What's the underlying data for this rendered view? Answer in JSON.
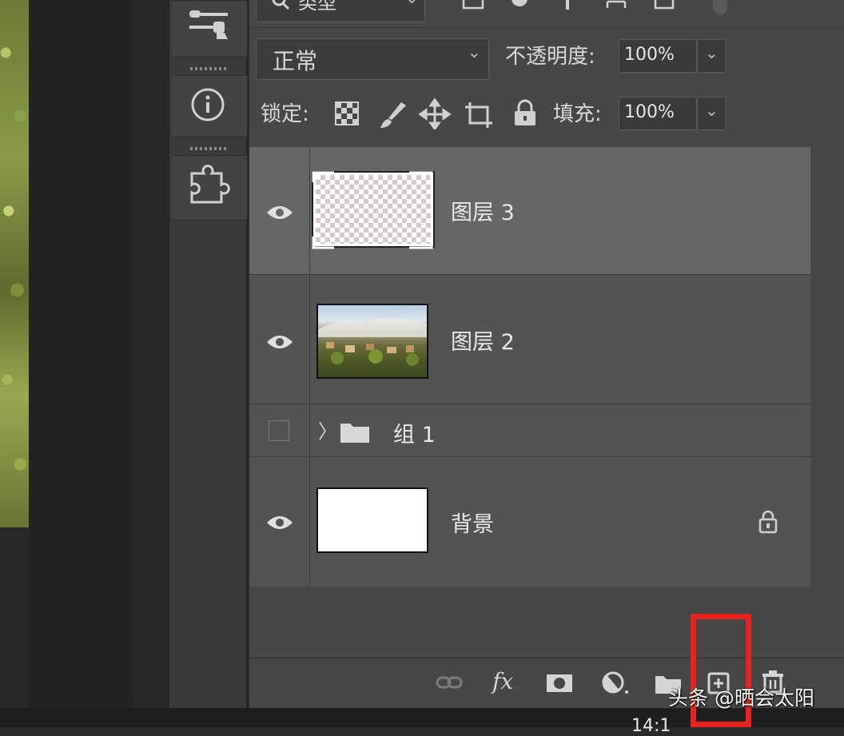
{
  "filter": {
    "kind_label": "类型"
  },
  "blend": {
    "mode": "正常",
    "opacity_label": "不透明度:",
    "opacity_value": "100%"
  },
  "lock": {
    "label": "锁定:",
    "fill_label": "填充:",
    "fill_value": "100%"
  },
  "layers": [
    {
      "name": "图层 3",
      "visible": true,
      "selected": true
    },
    {
      "name": "图层 2",
      "visible": true,
      "selected": false
    },
    {
      "name": "组 1",
      "visible": false,
      "selected": false
    },
    {
      "name": "背景",
      "visible": true,
      "selected": false,
      "locked": true
    }
  ],
  "footer_icons": [
    "link-layers-icon",
    "fx-icon",
    "mask-icon",
    "adjustment-icon",
    "group-folder-icon",
    "new-layer-icon",
    "delete-icon"
  ],
  "fx_text": "fx",
  "watermark": "头条 @晒会太阳",
  "time_text": "14:1",
  "colors": {
    "panel": "#474747",
    "selected_row": "#666666",
    "highlight": "#e8231f"
  }
}
